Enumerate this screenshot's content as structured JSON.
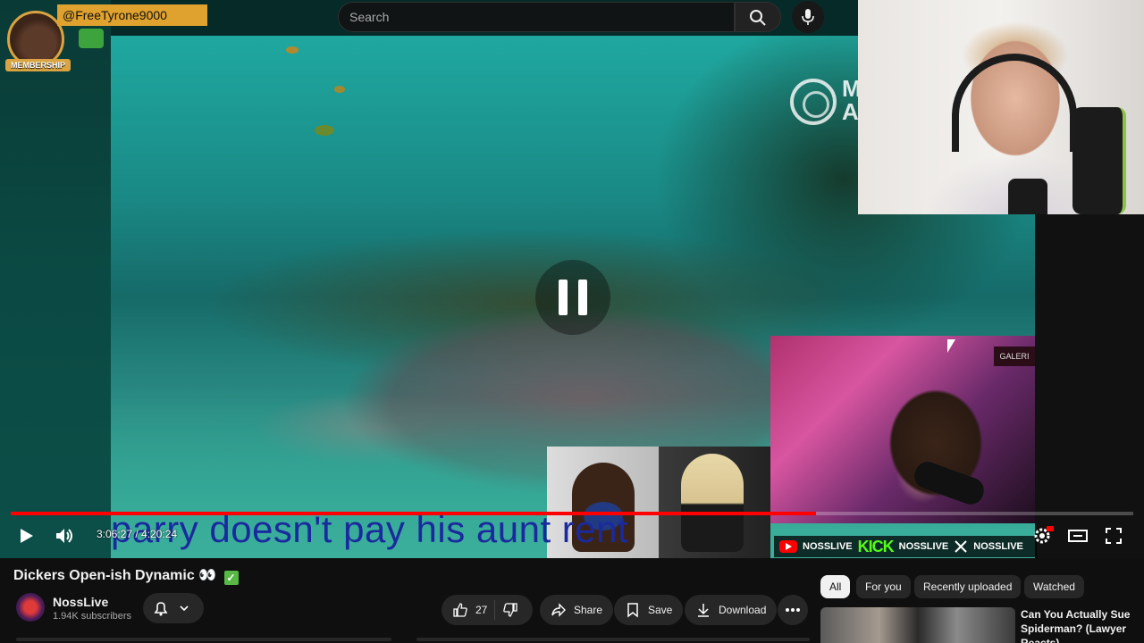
{
  "topbar": {
    "member_handle": "@FreeTyrone9000",
    "member_badge": "MEMBERSHIP",
    "search_placeholder": "Search"
  },
  "video": {
    "logo_letters": "M\nA",
    "caption": "parry doesn't pay his aunt rent",
    "cam_sign": "GALERI",
    "current_time": "3:06:27",
    "duration": "4:20:24",
    "time_display": "3:06:27 / 4:20:24",
    "progress_fraction": 0.7175,
    "brand_handles": [
      "NOSSLIVE",
      "NOSSLIVE",
      "NOSSLIVE"
    ],
    "kick_label": "KICK"
  },
  "meta": {
    "title": "Dickers Open-ish Dynamic",
    "title_emoji": "👀",
    "title_check": "✓",
    "channel_name": "NossLive",
    "subscribers": "1.94K subscribers",
    "like_count": "27",
    "share_label": "Share",
    "save_label": "Save",
    "download_label": "Download"
  },
  "recommendations": {
    "chips": [
      "All",
      "For you",
      "Recently uploaded",
      "Watched"
    ],
    "active_chip": "All",
    "first_title": "Can You Actually Sue Spiderman? (Lawyer Reacts)"
  },
  "colors": {
    "accent_red": "#ff0000",
    "membership_gold": "#e0a22e",
    "kick_green": "#53fc18"
  }
}
